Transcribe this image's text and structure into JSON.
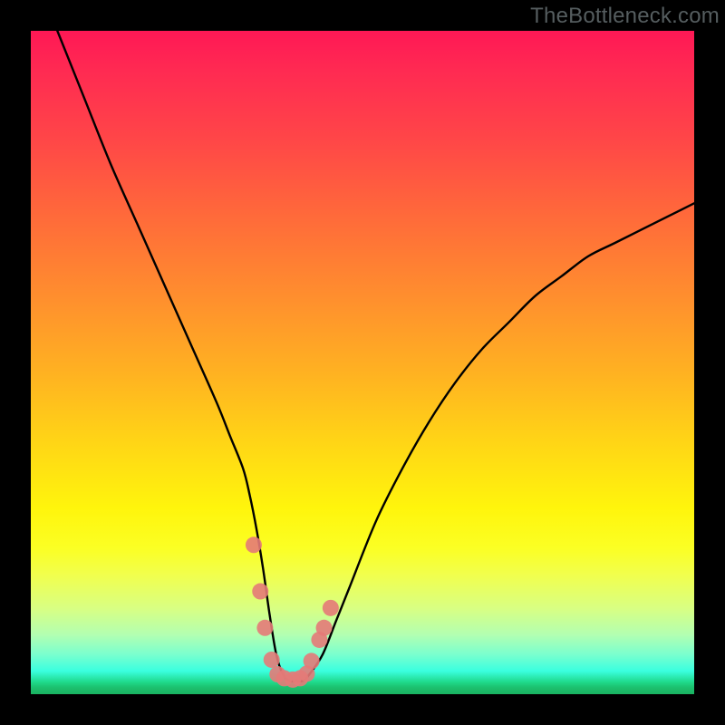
{
  "watermark": "TheBottleneck.com",
  "chart_data": {
    "type": "line",
    "title": "",
    "xlabel": "",
    "ylabel": "",
    "xlim": [
      0,
      100
    ],
    "ylim": [
      0,
      100
    ],
    "grid": false,
    "curve_color": "#000000",
    "marker_color": "#e47a78",
    "x": [
      4,
      8,
      12,
      16,
      20,
      24,
      28,
      30,
      32,
      33,
      34,
      35,
      36,
      37,
      38,
      39,
      40,
      41,
      42,
      44,
      46,
      48,
      52,
      56,
      60,
      64,
      68,
      72,
      76,
      80,
      84,
      88,
      92,
      96,
      100
    ],
    "y": [
      100,
      90,
      80,
      71,
      62,
      53,
      44,
      39,
      34,
      30,
      25,
      19,
      12,
      6,
      3,
      2,
      2,
      2,
      3,
      6,
      11,
      16,
      26,
      34,
      41,
      47,
      52,
      56,
      60,
      63,
      66,
      68,
      70,
      72,
      74
    ],
    "markers": {
      "x": [
        33.6,
        34.6,
        35.3,
        36.3,
        37.2,
        38.2,
        39.5,
        40.6,
        41.6,
        42.3,
        43.5,
        44.2,
        45.2
      ],
      "y": [
        22.5,
        15.5,
        10.0,
        5.2,
        3.0,
        2.4,
        2.2,
        2.4,
        3.1,
        5.0,
        8.2,
        10.0,
        13.0
      ]
    }
  }
}
